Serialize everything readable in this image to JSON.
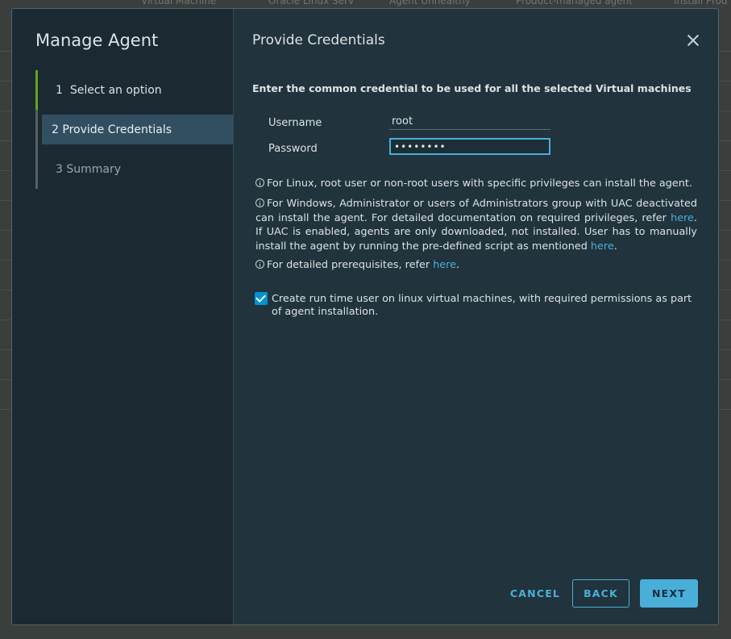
{
  "background": {
    "headers": [
      "Virtual Machine",
      "Oracle Linux Serv",
      "Agent Unhealthy",
      "Product-managed agent",
      "Install Prod"
    ]
  },
  "dialog": {
    "title": "Manage Agent",
    "steps": [
      {
        "number": "1",
        "label": "Select an option",
        "state": "done"
      },
      {
        "number": "2",
        "label": "Provide Credentials",
        "state": "active"
      },
      {
        "number": "3",
        "label": "Summary",
        "state": "pending"
      }
    ],
    "page_title": "Provide Credentials",
    "close_icon": "close-icon",
    "instruction": "Enter the common credential to be used for all the selected Virtual machines",
    "form": {
      "username_label": "Username",
      "username_value": "root",
      "password_label": "Password",
      "password_value": "••••••••"
    },
    "info": {
      "linux_text": "For Linux, root user or non-root users with specific privileges can install the agent.",
      "windows_text_1": "For Windows, Administrator or users of Administrators group with UAC deactivated can install the agent. For detailed documentation on required privileges, refer ",
      "windows_link_1": "here",
      "windows_text_2": ". If UAC is enabled, agents are only downloaded, not installed. User has to manually install the agent by running the pre-defined script as mentioned ",
      "windows_link_2": "here",
      "windows_text_3": ".",
      "prereq_text": "For detailed prerequisites, refer ",
      "prereq_link": "here",
      "prereq_text_end": "."
    },
    "checkbox": {
      "checked": true,
      "label": "Create run time user on linux virtual machines, with required permissions as part of agent installation."
    },
    "buttons": {
      "cancel": "CANCEL",
      "back": "BACK",
      "next": "NEXT"
    },
    "colors": {
      "accent": "#49afd9",
      "done_step": "#62a420",
      "checkbox": "#0094d2"
    }
  }
}
